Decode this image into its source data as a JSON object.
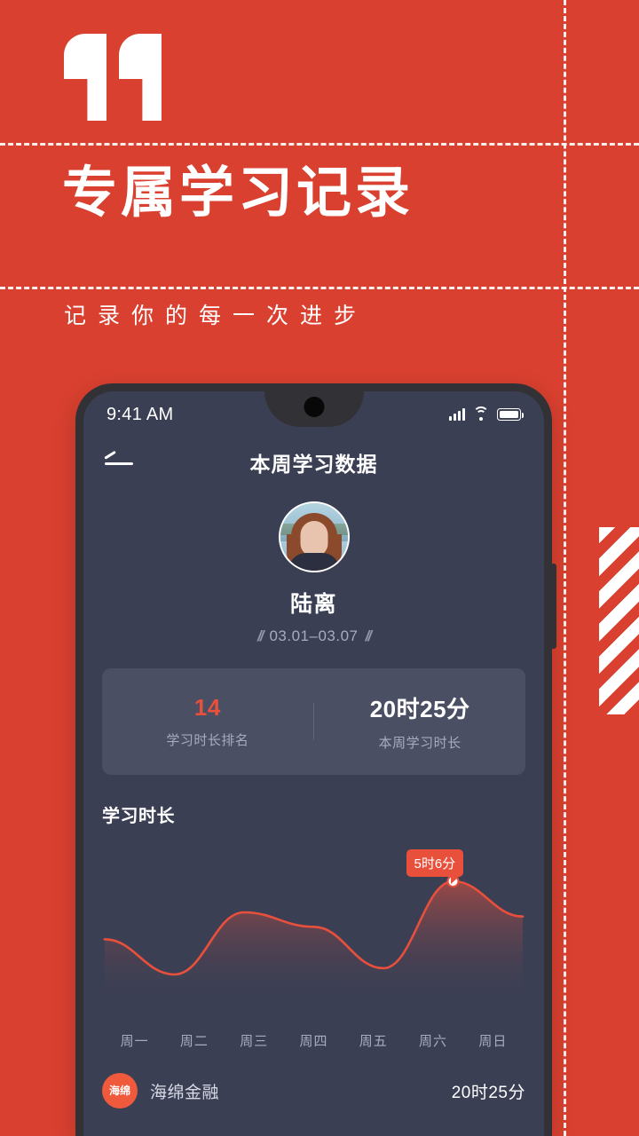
{
  "poster": {
    "quote_icon": "quotation-mark-icon",
    "headline": "专属学习记录",
    "subline": "记录你的每一次进步",
    "background_color": "#d9402f",
    "accent_color": "#e8503c"
  },
  "phone": {
    "status_bar": {
      "time": "9:41 AM",
      "signal_icon": "cellular-signal-icon",
      "wifi_icon": "wifi-icon",
      "battery_icon": "battery-full-icon"
    },
    "header": {
      "back_icon": "back-arrow-icon",
      "title": "本周学习数据"
    },
    "profile": {
      "avatar_icon": "user-avatar",
      "name": "陆离",
      "date_range": "03.01–03.07",
      "decoration_left": "//",
      "decoration_right": "//"
    },
    "stats": [
      {
        "value": "14",
        "label": "学习时长排名",
        "accent": true
      },
      {
        "value": "20时25分",
        "label": "本周学习时长",
        "accent": false
      }
    ],
    "chart_section_title": "学习时长",
    "app_list": [
      {
        "icon_text": "海绵",
        "name": "海绵金融",
        "duration": "20时25分"
      }
    ]
  },
  "chart_data": {
    "type": "area",
    "title": "学习时长",
    "categories": [
      "周一",
      "周二",
      "周三",
      "周四",
      "周五",
      "周六",
      "周日"
    ],
    "values": [
      2.3,
      0.6,
      3.6,
      2.9,
      0.9,
      5.1,
      3.4
    ],
    "unit": "小时",
    "xlabel": "",
    "ylabel": "",
    "ylim": [
      0,
      6
    ],
    "grid": false,
    "legend": false,
    "line_color": "#e8503c",
    "fill_gradient": [
      "#e8503c",
      "#3b3f54"
    ],
    "highlight": {
      "category": "周六",
      "value": 5.1,
      "label": "5时6分",
      "marker": "white-dot"
    }
  }
}
